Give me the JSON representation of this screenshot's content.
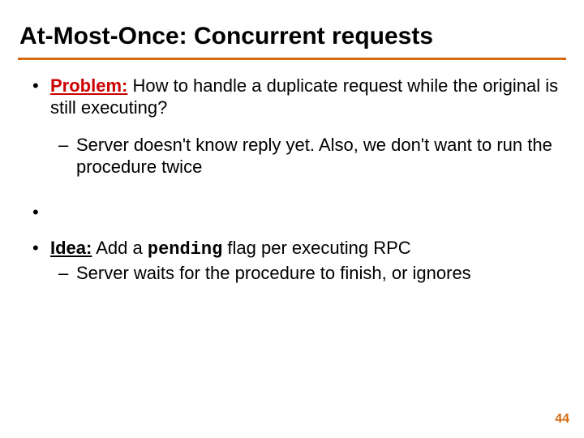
{
  "title": "At-Most-Once: Concurrent requests",
  "bullets": {
    "problem": {
      "label": "Problem:",
      "text": " How to handle a duplicate request while the original is still executing?",
      "sub": "Server doesn't know reply yet.  Also, we don't want to run the procedure twice"
    },
    "idea": {
      "label": "Idea:",
      "text_before": " Add a ",
      "code": "pending",
      "text_after": " flag per executing RPC",
      "sub": "Server waits for the procedure to finish, or ignores"
    }
  },
  "page_number": "44"
}
